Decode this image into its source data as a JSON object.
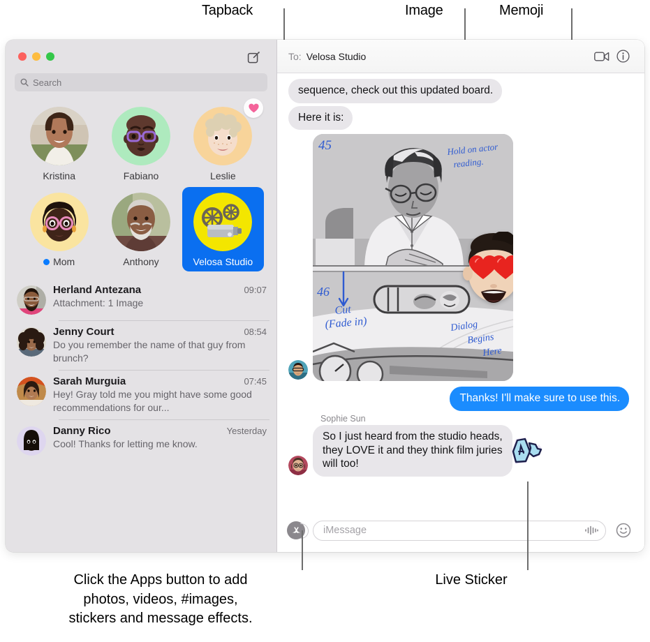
{
  "callouts": {
    "tapback": "Tapback",
    "image": "Image",
    "memoji": "Memoji",
    "apps_caption_line1": "Click the Apps button to add",
    "apps_caption_line2": "photos, videos, #images,",
    "apps_caption_line3": "stickers and message effects.",
    "live_sticker": "Live Sticker"
  },
  "sidebar": {
    "search": {
      "placeholder": "Search",
      "icon": "search-icon"
    },
    "compose_icon": "compose-icon",
    "pinned": [
      {
        "name": "Kristina",
        "type": "photo",
        "tapback": null,
        "unread": false,
        "selected": false
      },
      {
        "name": "Fabiano",
        "type": "memoji",
        "tapback": null,
        "unread": false,
        "selected": false
      },
      {
        "name": "Leslie",
        "type": "memoji",
        "tapback": "heart",
        "unread": false,
        "selected": false
      },
      {
        "name": "Mom",
        "type": "memoji",
        "tapback": null,
        "unread": true,
        "selected": false
      },
      {
        "name": "Anthony",
        "type": "photo",
        "tapback": null,
        "unread": false,
        "selected": false
      },
      {
        "name": "Velosa Studio",
        "type": "projector",
        "tapback": null,
        "unread": false,
        "selected": true
      }
    ],
    "conversations": [
      {
        "name": "Herland Antezana",
        "time": "09:07",
        "preview": "Attachment:  1 Image"
      },
      {
        "name": "Jenny Court",
        "time": "08:54",
        "preview": "Do you remember the name of that guy from brunch?"
      },
      {
        "name": "Sarah Murguia",
        "time": "07:45",
        "preview": "Hey! Gray told me you might have some good recommendations for our..."
      },
      {
        "name": "Danny Rico",
        "time": "Yesterday",
        "preview": "Cool! Thanks for letting me know."
      }
    ]
  },
  "conversation": {
    "to_label": "To:",
    "to_value": "Velosa Studio",
    "facetime_icon": "video-camera-icon",
    "info_icon": "info-icon",
    "messages": [
      {
        "id": "m1",
        "from": "them",
        "text": "sequence, check out this updated board."
      },
      {
        "id": "m2",
        "from": "them",
        "text": "Here it is:"
      },
      {
        "id": "m3",
        "from": "them",
        "type": "image",
        "alt": "Storyboard panels",
        "annotations": [
          "45",
          "Hold on actor reading",
          "46",
          "Cut (Fade in)",
          "Dialog Begins Here"
        ],
        "sticker": "memoji-heart-eyes"
      },
      {
        "id": "m4",
        "from": "me",
        "text": "Thanks! I'll make sure to use this."
      },
      {
        "id": "m5",
        "from": "them",
        "sender": "Sophie Sun",
        "text": "So I just heard from the studio heads, they LOVE it and they think film juries will too!",
        "sticker": "live-sticker-a"
      }
    ],
    "composer": {
      "apps_icon": "apps-button-icon",
      "placeholder": "iMessage",
      "audio_icon": "audio-waveform-icon",
      "emoji_icon": "emoji-smiley-icon"
    }
  },
  "colors": {
    "accent_blue": "#1b8cfe",
    "selected_blue": "#0a6ff0",
    "bubble_gray": "#e8e6ea",
    "sidebar_bg": "#e4e2e5",
    "unread_dot": "#0a7cff",
    "tapback_pink": "#f4639a"
  }
}
